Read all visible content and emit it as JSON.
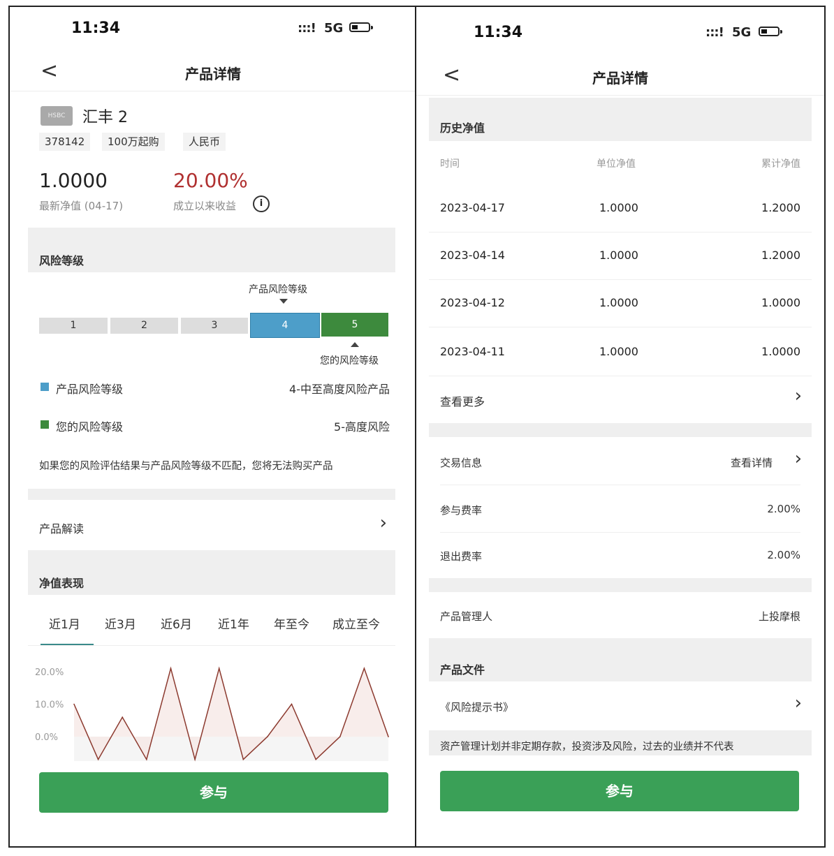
{
  "left": {
    "status": {
      "time": "11:34",
      "signal": ":::!",
      "network": "5G"
    },
    "nav": {
      "back": "<",
      "title": "产品详情"
    },
    "product": {
      "logo_text": "HSBC",
      "name": "汇丰 2",
      "tags": [
        "378142",
        "100万起购",
        "人民币"
      ],
      "nav_value": "1.0000",
      "nav_label": "最新净值 (04-17)",
      "return_value": "20.00%",
      "return_label": "成立以来收益",
      "info_icon": "i"
    },
    "risk": {
      "section_title": "风险等级",
      "product_marker_label": "产品风险等级",
      "levels": [
        "1",
        "2",
        "3",
        "4",
        "5"
      ],
      "user_marker_label": "您的风险等级",
      "legend_product_label": "产品风险等级",
      "legend_product_value": "4-中至高度风险产品",
      "legend_user_label": "您的风险等级",
      "legend_user_value": "5-高度风险",
      "notice": "如果您的风险评估结果与产品风险等级不匹配，您将无法购买产品",
      "colors": {
        "gray": "#dcdcdc",
        "product": "#4d9ec9",
        "user": "#3d8a3d"
      }
    },
    "interpret": {
      "label": "产品解读"
    },
    "performance": {
      "section_title": "净值表现",
      "tabs": [
        "近1月",
        "近3月",
        "近6月",
        "近1年",
        "年至今",
        "成立至今"
      ],
      "active_tab": 0
    },
    "chart_data": {
      "type": "area",
      "yticks": [
        "20.0%",
        "10.0%",
        "0.0%"
      ],
      "ylim": [
        -7.5,
        20
      ],
      "values": [
        10,
        -7,
        6,
        -7,
        21,
        -7,
        21,
        -7,
        0,
        10,
        -7,
        0,
        21,
        0
      ],
      "line_color": "#8c3a2f"
    },
    "cta": {
      "label": "参与"
    }
  },
  "right": {
    "status": {
      "time": "11:34",
      "signal": ":::!",
      "network": "5G"
    },
    "nav": {
      "back": "<",
      "title": "产品详情"
    },
    "history": {
      "section_title": "历史净值",
      "headers": [
        "时间",
        "单位净值",
        "累计净值"
      ],
      "rows": [
        [
          "2023-04-17",
          "1.0000",
          "1.2000"
        ],
        [
          "2023-04-14",
          "1.0000",
          "1.2000"
        ],
        [
          "2023-04-12",
          "1.0000",
          "1.0000"
        ],
        [
          "2023-04-11",
          "1.0000",
          "1.0000"
        ]
      ],
      "more_label": "查看更多"
    },
    "trade": {
      "label": "交易信息",
      "detail_link": "查看详情",
      "fee_in_label": "参与费率",
      "fee_in_value": "2.00%",
      "fee_out_label": "退出费率",
      "fee_out_value": "2.00%"
    },
    "manager": {
      "label": "产品管理人",
      "value": "上投摩根"
    },
    "files": {
      "section_title": "产品文件",
      "doc_label": "《风险提示书》",
      "disclaimer": "资产管理计划并非定期存款，投资涉及风险，过去的业绩并不代表"
    },
    "cta": {
      "label": "参与"
    }
  }
}
